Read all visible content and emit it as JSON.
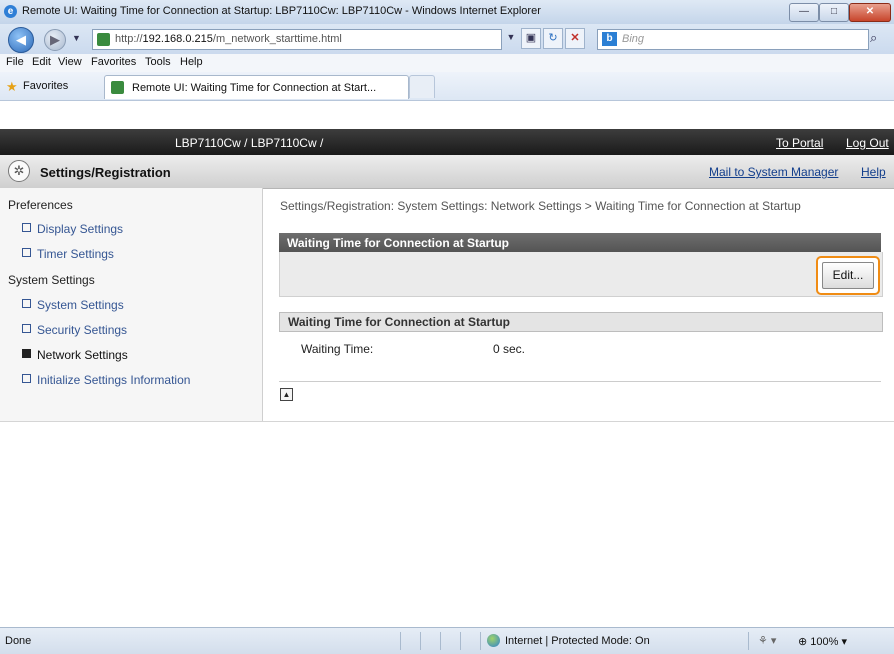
{
  "window": {
    "title": "Remote UI: Waiting Time for Connection at Startup: LBP7110Cw: LBP7110Cw - Windows Internet Explorer",
    "minimize": "—",
    "maximize": "□",
    "close": "✕"
  },
  "address": {
    "url_prefix": "http://",
    "url_host": "192.168.0.215",
    "url_path": "/m_network_starttime.html",
    "search_placeholder": "Bing",
    "search_engine": "b"
  },
  "menu": [
    "File",
    "Edit",
    "View",
    "Favorites",
    "Tools",
    "Help"
  ],
  "favorites": {
    "label": "Favorites",
    "tab_label": "Remote UI: Waiting Time for Connection at Start..."
  },
  "header": {
    "device_path": "LBP7110Cw / LBP7110Cw /",
    "to_portal": "To Portal",
    "log_out": "Log Out",
    "page_title": "Settings/Registration",
    "mail_link": "Mail to System Manager",
    "help_link": "Help"
  },
  "sidebar": {
    "preferences": "Preferences",
    "pref_items": [
      "Display Settings",
      "Timer Settings"
    ],
    "system_settings": "System Settings",
    "sys_items": [
      "System Settings",
      "Security Settings",
      "Network Settings",
      "Initialize Settings Information"
    ],
    "active": "Network Settings"
  },
  "main": {
    "breadcrumb": "Settings/Registration: System Settings: Network Settings > Waiting Time for Connection at Startup",
    "section_title": "Waiting Time for Connection at Startup",
    "edit_button": "Edit...",
    "subsection_title": "Waiting Time for Connection at Startup",
    "waiting_time_label": "Waiting Time:",
    "waiting_time_value": "0 sec."
  },
  "status": {
    "left": "Done",
    "zone": "Internet | Protected Mode: On",
    "zoom": "100%"
  },
  "colors": {
    "highlight": "#f08c14",
    "link": "#355693",
    "section_bar": "#5f5f5f"
  }
}
